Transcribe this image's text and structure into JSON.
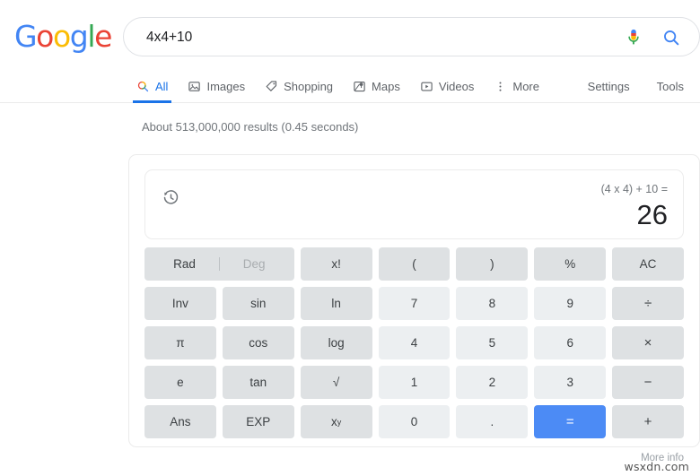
{
  "brand": {
    "logo_letters": [
      {
        "char": "G",
        "color": "#4285F4"
      },
      {
        "char": "o",
        "color": "#EA4335"
      },
      {
        "char": "o",
        "color": "#FBBC05"
      },
      {
        "char": "g",
        "color": "#4285F4"
      },
      {
        "char": "l",
        "color": "#34A853"
      },
      {
        "char": "e",
        "color": "#EA4335"
      }
    ],
    "accent_blue": "#1a73e8",
    "equals_blue": "#4c8bf5"
  },
  "search": {
    "query": "4x4+10",
    "placeholder": "Search",
    "mic_icon": "microphone-icon",
    "search_icon": "search-icon"
  },
  "nav": {
    "tabs": [
      {
        "label": "All",
        "icon": "search-icon",
        "active": true
      },
      {
        "label": "Images",
        "icon": "image-icon",
        "active": false
      },
      {
        "label": "Shopping",
        "icon": "tag-icon",
        "active": false
      },
      {
        "label": "Maps",
        "icon": "map-pin-icon",
        "active": false
      },
      {
        "label": "Videos",
        "icon": "video-play-icon",
        "active": false
      },
      {
        "label": "More",
        "icon": "more-vertical-icon",
        "active": false
      }
    ],
    "links": [
      {
        "label": "Settings"
      },
      {
        "label": "Tools"
      }
    ]
  },
  "results": {
    "stats": "About 513,000,000 results (0.45 seconds)"
  },
  "calculator": {
    "history_icon": "history-clock-icon",
    "expression": "(4 x 4) + 10 =",
    "result": "26",
    "angle_mode": {
      "rad_label": "Rad",
      "deg_label": "Deg",
      "selected": "Rad"
    },
    "keys": [
      {
        "label": "x!",
        "kind": "func",
        "name": "factorial"
      },
      {
        "label": "(",
        "kind": "func",
        "name": "open-paren"
      },
      {
        "label": ")",
        "kind": "func",
        "name": "close-paren"
      },
      {
        "label": "%",
        "kind": "func",
        "name": "percent"
      },
      {
        "label": "AC",
        "kind": "func",
        "name": "all-clear"
      },
      {
        "label": "Inv",
        "kind": "func",
        "name": "inverse"
      },
      {
        "label": "sin",
        "kind": "func",
        "name": "sin"
      },
      {
        "label": "ln",
        "kind": "func",
        "name": "ln"
      },
      {
        "label": "7",
        "kind": "num",
        "name": "7"
      },
      {
        "label": "8",
        "kind": "num",
        "name": "8"
      },
      {
        "label": "9",
        "kind": "num",
        "name": "9"
      },
      {
        "label": "÷",
        "kind": "op",
        "name": "divide"
      },
      {
        "label": "π",
        "kind": "func",
        "name": "pi"
      },
      {
        "label": "cos",
        "kind": "func",
        "name": "cos"
      },
      {
        "label": "log",
        "kind": "func",
        "name": "log"
      },
      {
        "label": "4",
        "kind": "num",
        "name": "4"
      },
      {
        "label": "5",
        "kind": "num",
        "name": "5"
      },
      {
        "label": "6",
        "kind": "num",
        "name": "6"
      },
      {
        "label": "×",
        "kind": "op",
        "name": "multiply"
      },
      {
        "label": "e",
        "kind": "func",
        "name": "e"
      },
      {
        "label": "tan",
        "kind": "func",
        "name": "tan"
      },
      {
        "label": "√",
        "kind": "func",
        "name": "square-root"
      },
      {
        "label": "1",
        "kind": "num",
        "name": "1"
      },
      {
        "label": "2",
        "kind": "num",
        "name": "2"
      },
      {
        "label": "3",
        "kind": "num",
        "name": "3"
      },
      {
        "label": "−",
        "kind": "op",
        "name": "subtract"
      },
      {
        "label": "Ans",
        "kind": "func",
        "name": "answer"
      },
      {
        "label": "EXP",
        "kind": "func",
        "name": "exponent"
      },
      {
        "label": "x^y",
        "kind": "func",
        "name": "power",
        "superscript": "y",
        "base": "x"
      },
      {
        "label": "0",
        "kind": "num",
        "name": "0"
      },
      {
        "label": ".",
        "kind": "num",
        "name": "decimal-point"
      },
      {
        "label": "=",
        "kind": "equals",
        "name": "equals"
      },
      {
        "label": "+",
        "kind": "op",
        "name": "add"
      }
    ]
  },
  "footer": {
    "more_info": "More info",
    "watermark": "wsxdn.com"
  }
}
